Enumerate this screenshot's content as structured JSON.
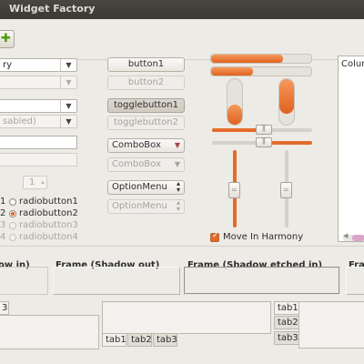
{
  "window": {
    "title": "Widget Factory"
  },
  "toolbar": {
    "add_icon": "add-icon"
  },
  "col1": {
    "combo1": "ry",
    "combo3_insens": "sabled)",
    "spin_value": "1",
    "radios_a": [
      "1",
      "2",
      "3",
      "4"
    ],
    "radios_b": [
      "radiobutton1",
      "radiobutton2",
      "radiobutton3",
      "radiobutton4"
    ]
  },
  "col2": {
    "button1": "button1",
    "button2": "button2",
    "toggle1": "togglebutton1",
    "toggle2": "togglebutton2",
    "combo_box": "ComboBox",
    "combo_box_insens": "ComboBox",
    "option_menu": "OptionMenu",
    "option_menu_insens": "OptionMenu"
  },
  "scales": {
    "hprogress1": 0.72,
    "hprogress2": 0.42,
    "vprogress1": 0.45,
    "vprogress2": 0.75,
    "hscale1": 0.5,
    "hscale2": 0.5,
    "vscale1": 0.5,
    "vscale2": 0.5,
    "move_in_harmony": "Move In Harmony",
    "move_in_harmony_checked": true,
    "accent": "#e3662d"
  },
  "list": {
    "column_header": "Colum"
  },
  "frames": {
    "f1": "ow in)",
    "f2": "Frame (Shadow out)",
    "f3": "Frame (Shadow etched in)",
    "f4": "Fra"
  },
  "notebooks": {
    "nb1_tab": "3",
    "nb2_tabs": [
      "tab1",
      "tab2",
      "tab3"
    ],
    "nb3_tabs": [
      "tab1",
      "tab2",
      "tab3"
    ]
  }
}
